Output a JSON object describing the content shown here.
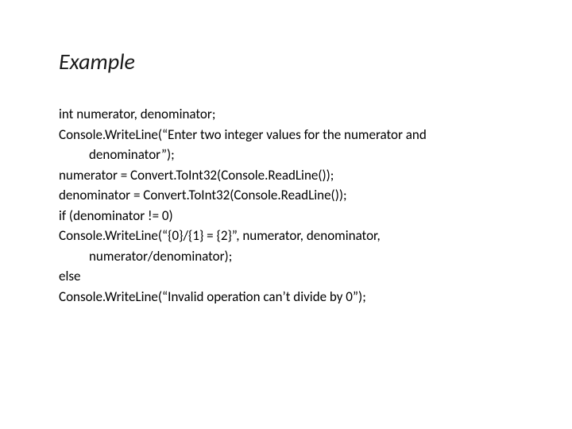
{
  "title": "Example",
  "code": {
    "line1": "int numerator, denominator;",
    "line2a": "Console.WriteLine(“Enter two integer values for the numerator and",
    "line2b": "denominator”);",
    "line3": "numerator = Convert.ToInt32(Console.ReadLine());",
    "line4": "denominator = Convert.ToInt32(Console.ReadLine());",
    "line5": "if (denominator != 0)",
    "line6a": "Console.WriteLine(“{0}/{1} = {2}”, numerator, denominator,",
    "line6b": "numerator/denominator);",
    "line7": "else",
    "line8": "Console.WriteLine(“Invalid operation can’t divide by 0”);"
  }
}
